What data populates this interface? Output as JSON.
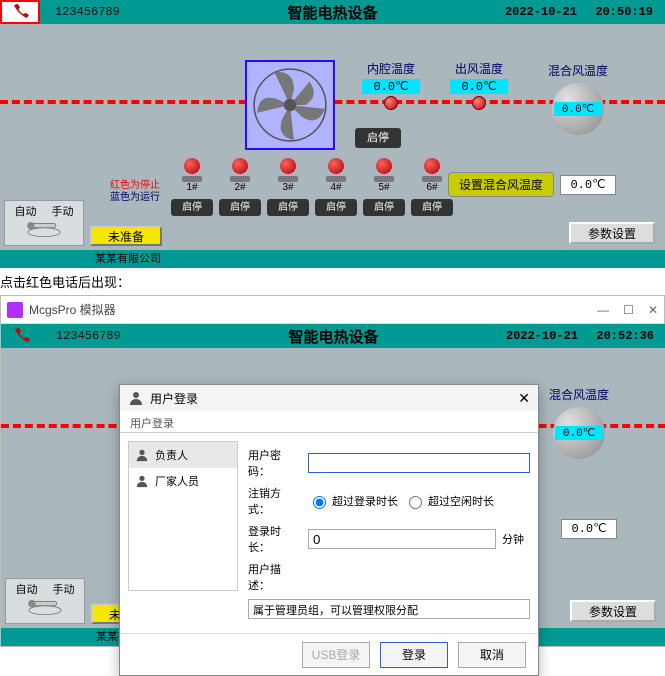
{
  "top": {
    "number": "123456789",
    "title": "智能电热设备",
    "date": "2022-10-21",
    "time1": "20:50:19",
    "time2": "20:52:36"
  },
  "temps": {
    "inner_label": "内腔温度",
    "out_label": "出风温度",
    "mix_label": "混合风温度",
    "zero": "0.0℃"
  },
  "fan_btn": "启停",
  "lamps": {
    "legend_red": "红色为停止",
    "legend_blue": "蓝色为运行",
    "labels": [
      "1#",
      "2#",
      "3#",
      "4#",
      "5#",
      "6#"
    ],
    "btn": "启停"
  },
  "set_temp": {
    "label": "设置混合风温度",
    "value": "0.0℃"
  },
  "mode": {
    "auto": "自动",
    "manual": "手动"
  },
  "status": "未准备",
  "param_btn": "参数设置",
  "footer": "某某有限公司",
  "caption": "点击红色电话后出现：",
  "win_title": "McgsPro 模拟器",
  "dialog": {
    "title": "用户登录",
    "sub": "用户登录",
    "roles": [
      "负责人",
      "厂家人员"
    ],
    "pw_label": "用户密码：",
    "logout_label": "注销方式：",
    "logout_opt1": "超过登录时长",
    "logout_opt2": "超过空闲时长",
    "duration_label": "登录时长：",
    "duration_value": "0",
    "duration_unit": "分钟",
    "desc_label": "用户描述：",
    "desc_value": "属于管理员组，可以管理权限分配",
    "btn_usb": "USB登录",
    "btn_login": "登录",
    "btn_cancel": "取消"
  }
}
